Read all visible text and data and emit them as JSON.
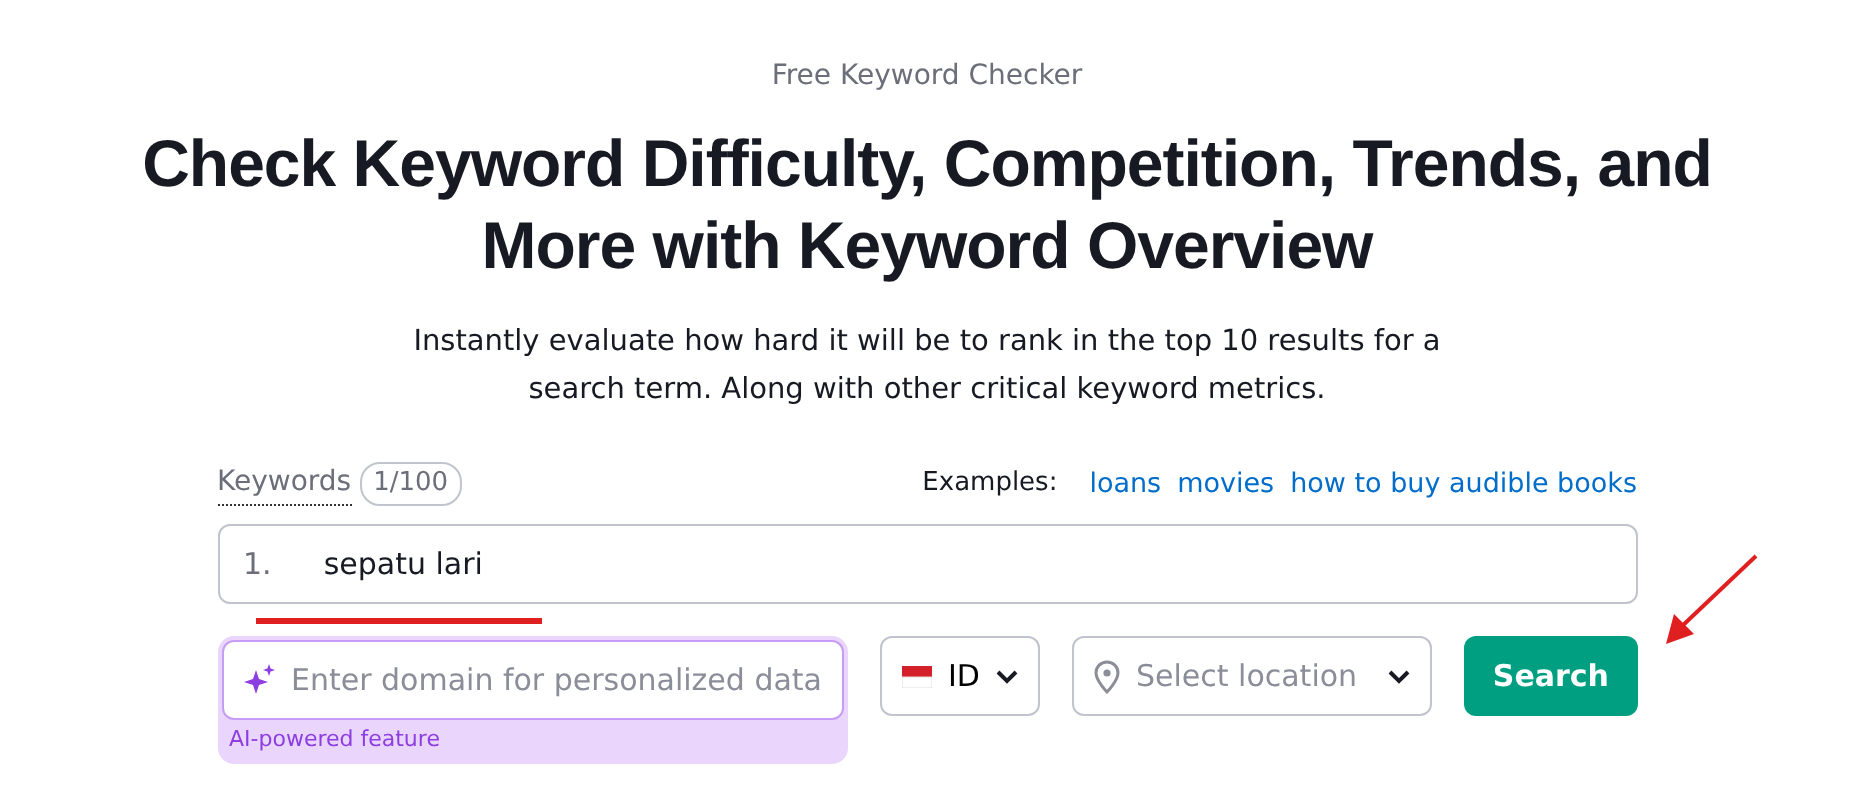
{
  "eyebrow": "Free Keyword Checker",
  "title": "Check Keyword Difficulty, Competition, Trends, and More with Keyword Overview",
  "description": "Instantly evaluate how hard it will be to rank in the top 10 results for a search term. Along with other critical keyword metrics.",
  "keywords": {
    "label": "Keywords",
    "count": "1/100",
    "examples_label": "Examples:",
    "examples": [
      "loans",
      "movies",
      "how to buy audible books"
    ],
    "rows": [
      {
        "number": "1.",
        "value": "sepatu lari"
      }
    ]
  },
  "domain": {
    "placeholder": "Enter domain for personalized data",
    "note": "AI-powered feature"
  },
  "country": {
    "code": "ID"
  },
  "location": {
    "placeholder": "Select location"
  },
  "search_button": "Search"
}
